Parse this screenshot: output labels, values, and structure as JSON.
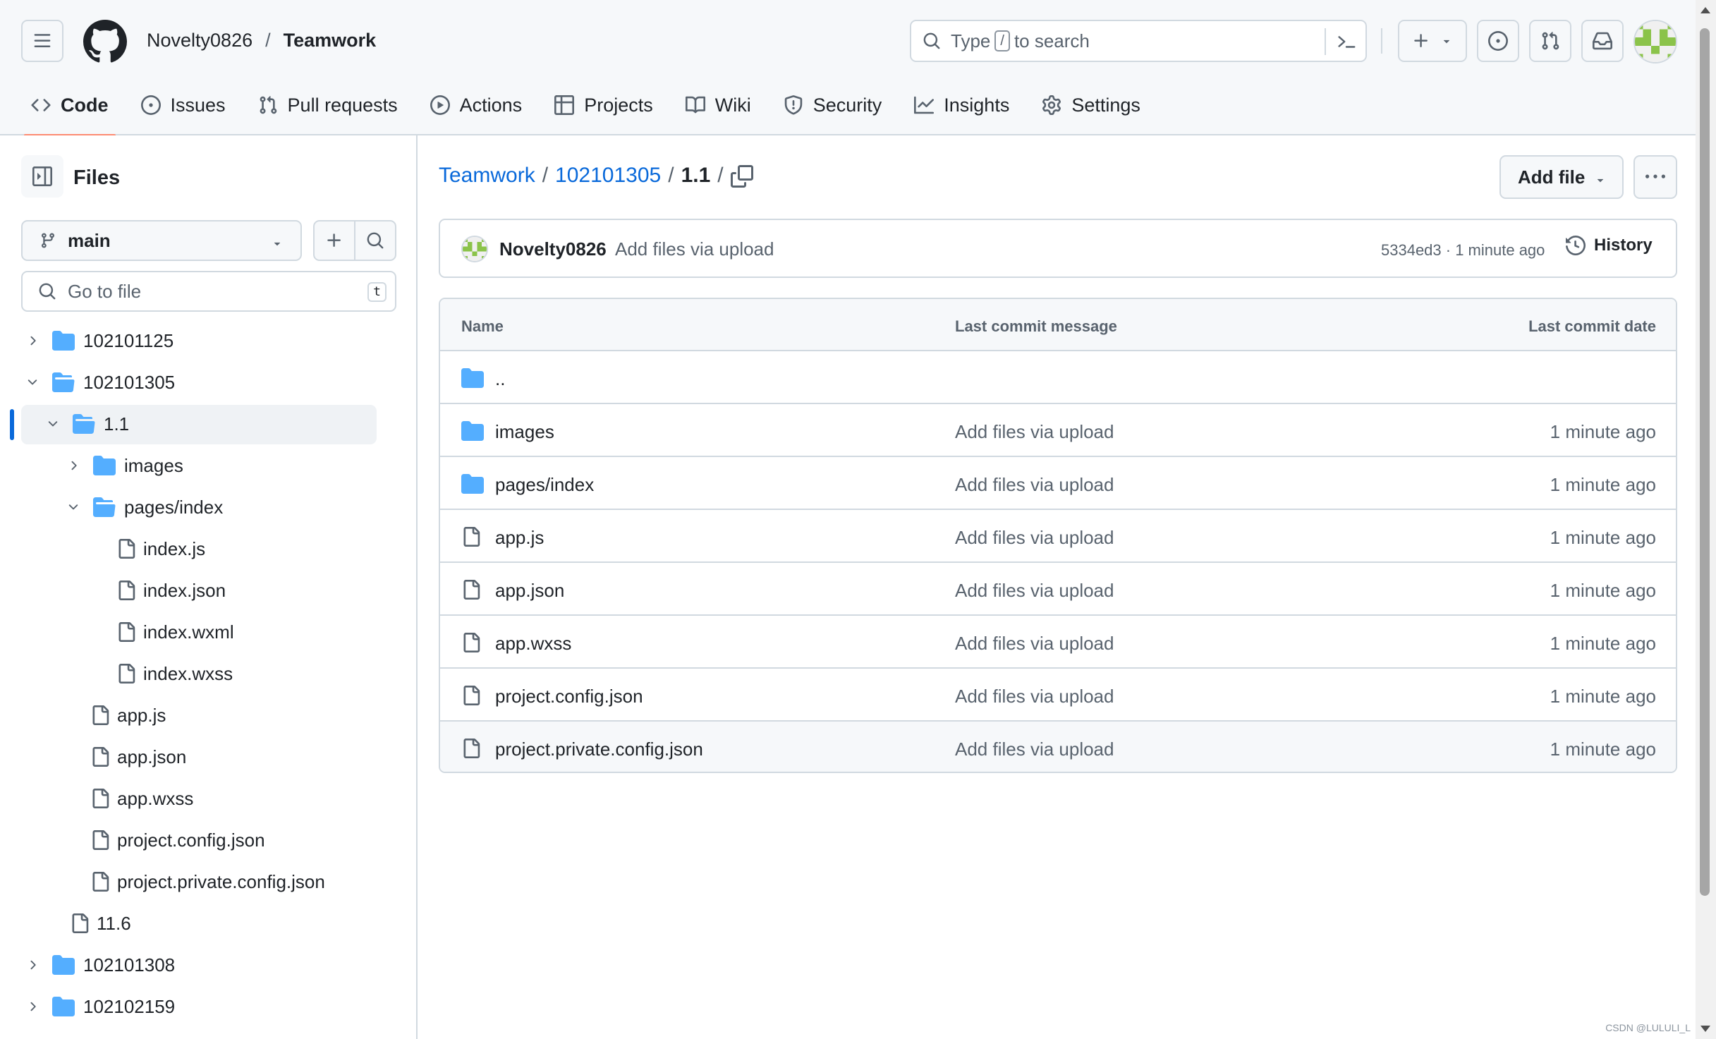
{
  "colors": {
    "accent": "#0969da",
    "folder": "#54aeff",
    "tab_underline": "#fd8c73",
    "border": "#d1d9e0",
    "muted": "#59636e"
  },
  "header": {
    "owner": "Novelty0826",
    "separator": "/",
    "repo": "Teamwork",
    "search": {
      "before": "Type",
      "key": "/",
      "after": "to search"
    }
  },
  "tabs": [
    {
      "label": "Code",
      "icon": "code-icon"
    },
    {
      "label": "Issues",
      "icon": "issue-opened-icon"
    },
    {
      "label": "Pull requests",
      "icon": "git-pull-request-icon"
    },
    {
      "label": "Actions",
      "icon": "play-icon"
    },
    {
      "label": "Projects",
      "icon": "table-icon"
    },
    {
      "label": "Wiki",
      "icon": "book-icon"
    },
    {
      "label": "Security",
      "icon": "shield-icon"
    },
    {
      "label": "Insights",
      "icon": "graph-icon"
    },
    {
      "label": "Settings",
      "icon": "gear-icon"
    }
  ],
  "sidebar": {
    "title": "Files",
    "branch": "main",
    "goto_placeholder": "Go to file",
    "goto_key": "t",
    "tree": [
      {
        "label": "102101125",
        "type": "folder",
        "depth": 0,
        "expanded": false
      },
      {
        "label": "102101305",
        "type": "folder",
        "depth": 0,
        "expanded": true
      },
      {
        "label": "1.1",
        "type": "folder",
        "depth": 1,
        "expanded": true,
        "selected": true
      },
      {
        "label": "images",
        "type": "folder",
        "depth": 2,
        "expanded": false
      },
      {
        "label": "pages/index",
        "type": "folder",
        "depth": 2,
        "expanded": true
      },
      {
        "label": "index.js",
        "type": "file",
        "depth": 3
      },
      {
        "label": "index.json",
        "type": "file",
        "depth": 3
      },
      {
        "label": "index.wxml",
        "type": "file",
        "depth": 3
      },
      {
        "label": "index.wxss",
        "type": "file",
        "depth": 3
      },
      {
        "label": "app.js",
        "type": "file",
        "depth": 2
      },
      {
        "label": "app.json",
        "type": "file",
        "depth": 2
      },
      {
        "label": "app.wxss",
        "type": "file",
        "depth": 2
      },
      {
        "label": "project.config.json",
        "type": "file",
        "depth": 2
      },
      {
        "label": "project.private.config.json",
        "type": "file",
        "depth": 2
      },
      {
        "label": "11.6",
        "type": "file",
        "depth": 1
      },
      {
        "label": "102101308",
        "type": "folder",
        "depth": 0,
        "expanded": false
      },
      {
        "label": "102102159",
        "type": "folder",
        "depth": 0,
        "expanded": false
      }
    ]
  },
  "main": {
    "breadcrumb": {
      "root": "Teamwork",
      "folder": "102101305",
      "current": "1.1",
      "sep": "/"
    },
    "add_file": "Add file",
    "commit": {
      "author": "Novelty0826",
      "message": "Add files via upload",
      "meta": "5334ed3 · 1 minute ago",
      "history": "History"
    },
    "table": {
      "headers": {
        "name": "Name",
        "message": "Last commit message",
        "date": "Last commit date"
      },
      "rows": [
        {
          "name": "..",
          "type": "folder",
          "message": "",
          "date": ""
        },
        {
          "name": "images",
          "type": "folder",
          "message": "Add files via upload",
          "date": "1 minute ago"
        },
        {
          "name": "pages/index",
          "type": "folder",
          "message": "Add files via upload",
          "date": "1 minute ago"
        },
        {
          "name": "app.js",
          "type": "file",
          "message": "Add files via upload",
          "date": "1 minute ago"
        },
        {
          "name": "app.json",
          "type": "file",
          "message": "Add files via upload",
          "date": "1 minute ago"
        },
        {
          "name": "app.wxss",
          "type": "file",
          "message": "Add files via upload",
          "date": "1 minute ago"
        },
        {
          "name": "project.config.json",
          "type": "file",
          "message": "Add files via upload",
          "date": "1 minute ago"
        },
        {
          "name": "project.private.config.json",
          "type": "file",
          "message": "Add files via upload",
          "date": "1 minute ago"
        }
      ]
    }
  },
  "watermark": "CSDN @LULULI_L"
}
